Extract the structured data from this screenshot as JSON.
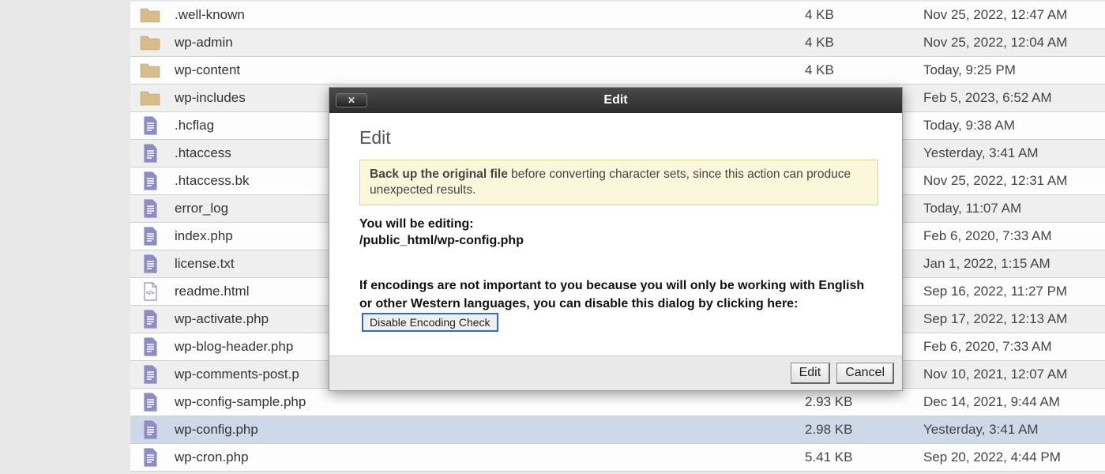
{
  "files": [
    {
      "name": ".well-known",
      "size": "4 KB",
      "date": "Nov 25, 2022, 12:47 AM",
      "type": "folder"
    },
    {
      "name": "wp-admin",
      "size": "4 KB",
      "date": "Nov 25, 2022, 12:04 AM",
      "type": "folder"
    },
    {
      "name": "wp-content",
      "size": "4 KB",
      "date": "Today, 9:25 PM",
      "type": "folder"
    },
    {
      "name": "wp-includes",
      "size": "",
      "date": "Feb 5, 2023, 6:52 AM",
      "type": "folder"
    },
    {
      "name": ".hcflag",
      "size": "",
      "date": "Today, 9:38 AM",
      "type": "file"
    },
    {
      "name": ".htaccess",
      "size": "",
      "date": "Yesterday, 3:41 AM",
      "type": "file"
    },
    {
      "name": ".htaccess.bk",
      "size": "",
      "date": "Nov 25, 2022, 12:31 AM",
      "type": "file"
    },
    {
      "name": "error_log",
      "size": "",
      "date": "Today, 11:07 AM",
      "type": "file"
    },
    {
      "name": "index.php",
      "size": "",
      "date": "Feb 6, 2020, 7:33 AM",
      "type": "file"
    },
    {
      "name": "license.txt",
      "size": "",
      "date": "Jan 1, 2022, 1:15 AM",
      "type": "file"
    },
    {
      "name": "readme.html",
      "size": "",
      "date": "Sep 16, 2022, 11:27 PM",
      "type": "html"
    },
    {
      "name": "wp-activate.php",
      "size": "",
      "date": "Sep 17, 2022, 12:13 AM",
      "type": "file"
    },
    {
      "name": "wp-blog-header.php",
      "size": "",
      "date": "Feb 6, 2020, 7:33 AM",
      "type": "file"
    },
    {
      "name": "wp-comments-post.p",
      "size": "",
      "date": "Nov 10, 2021, 12:07 AM",
      "type": "file"
    },
    {
      "name": "wp-config-sample.php",
      "size": "2.93 KB",
      "date": "Dec 14, 2021, 9:44 AM",
      "type": "file"
    },
    {
      "name": "wp-config.php",
      "size": "2.98 KB",
      "date": "Yesterday, 3:41 AM",
      "type": "file",
      "selected": true
    },
    {
      "name": "wp-cron.php",
      "size": "5.41 KB",
      "date": "Sep 20, 2022, 4:44 PM",
      "type": "file"
    }
  ],
  "modal": {
    "titlebar": "Edit",
    "heading": "Edit",
    "warning_bold": "Back up the original file",
    "warning_rest": " before converting character sets, since this action can produce unexpected results.",
    "editing_label": "You will be editing:",
    "editing_path": "/public_html/wp-config.php",
    "enc_text_prefix": "If encodings are not important to you because you will only be working with English or other Western languages, you can disable this dialog by clicking here: ",
    "disable_btn": "Disable Encoding Check",
    "footer_edit": "Edit",
    "footer_cancel": "Cancel"
  }
}
